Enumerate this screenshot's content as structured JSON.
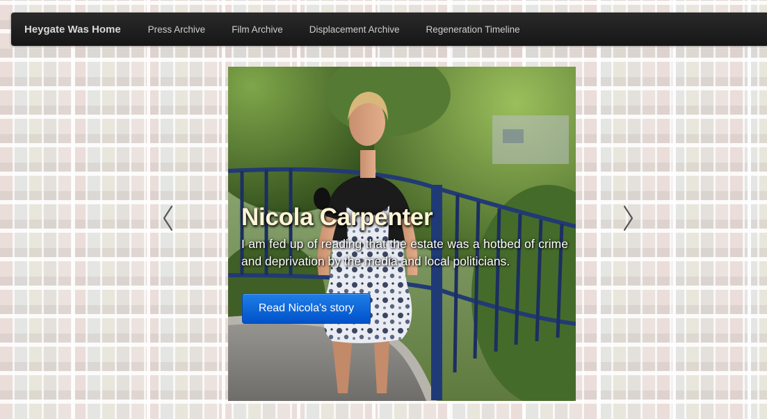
{
  "navbar": {
    "brand": "Heygate Was Home",
    "items": [
      {
        "label": "Press Archive"
      },
      {
        "label": "Film Archive"
      },
      {
        "label": "Displacement Archive"
      },
      {
        "label": "Regeneration Timeline"
      }
    ]
  },
  "carousel": {
    "slide": {
      "title": "Nicola Carpenter",
      "text": "I am fed up of reading that the estate was a hotbed of crime and deprivation by the media and local politicians.",
      "button_label": "Read Nicola's story"
    },
    "prev_icon": "chevron-left-icon",
    "next_icon": "chevron-right-icon"
  },
  "colors": {
    "navbar": "#1d1d1d",
    "button": "#0a66d8",
    "title_text": "#fff4d6"
  }
}
